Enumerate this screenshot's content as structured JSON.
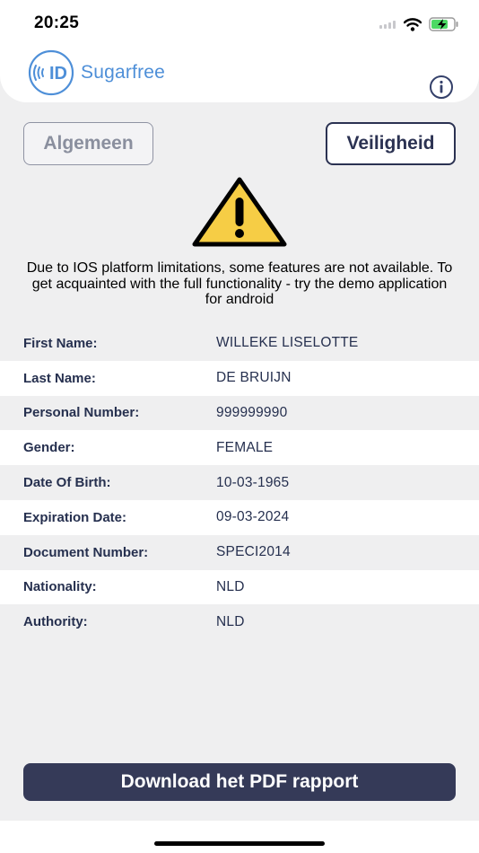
{
  "status_bar": {
    "time": "20:25"
  },
  "header": {
    "logo_text": "Sugarfree"
  },
  "tabs": [
    {
      "label": "Algemeen",
      "active": false
    },
    {
      "label": "Veiligheid",
      "active": true
    }
  ],
  "notice": "Due to IOS platform limitations, some features are not available. To get acquainted with the full functionality - try the demo application for android",
  "fields": [
    {
      "label": "First Name:",
      "value": "WILLEKE LISELOTTE"
    },
    {
      "label": "Last Name:",
      "value": "DE BRUIJN"
    },
    {
      "label": "Personal Number:",
      "value": "999999990"
    },
    {
      "label": "Gender:",
      "value": "FEMALE"
    },
    {
      "label": "Date Of Birth:",
      "value": "10-03-1965"
    },
    {
      "label": "Expiration Date:",
      "value": "09-03-2024"
    },
    {
      "label": "Document Number:",
      "value": "SPECI2014"
    },
    {
      "label": "Nationality:",
      "value": "NLD"
    },
    {
      "label": "Authority:",
      "value": "NLD"
    }
  ],
  "download_label": "Download het PDF rapport",
  "colors": {
    "brand_blue": "#4e8fd8",
    "navy": "#353a58",
    "warning_yellow": "#f6cd45"
  }
}
